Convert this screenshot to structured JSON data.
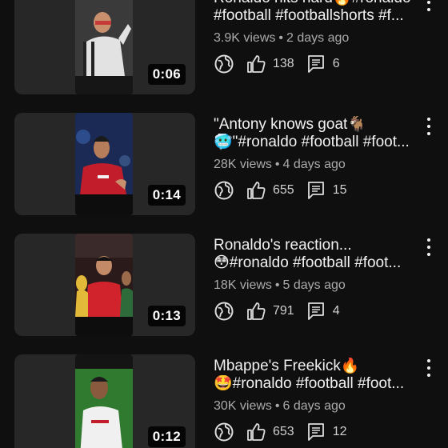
{
  "videos": [
    {
      "title_line1": "Ronaldo hits hard🔥#ronaldo",
      "title_line2": "#football #footballshorts #f...",
      "views": "3.9K views",
      "age": "2 days ago",
      "likes": "138",
      "comments": "6",
      "duration": "0:06",
      "thumb_colors": [
        "#2a2a2a",
        "#d9d9d9",
        "#c63a3a"
      ]
    },
    {
      "title_line1": "\"Antony knows goat🐐",
      "title_line2": "🥶\"#ronaldo #football #foot...",
      "views": "28K views",
      "age": "4 days ago",
      "likes": "655",
      "comments": "15",
      "duration": "0:14",
      "thumb_colors": [
        "#1b2a55",
        "#c21d2a",
        "#e7e7e7"
      ]
    },
    {
      "title_line1": "Ronaldo's reaction...",
      "title_line2": "😳#ronaldo #football #foot...",
      "views": "18K views",
      "age": "5 days ago",
      "likes": "791",
      "comments": "4",
      "duration": "0:13",
      "thumb_colors": [
        "#3a1f1f",
        "#d0232b",
        "#2e6b3a"
      ]
    },
    {
      "title_line1": "Mbappe's Freekick🔥",
      "title_line2": "🤩#ronaldo #football #foot...",
      "views": "30K views",
      "age": "6 days ago",
      "likes": "653",
      "comments": "12",
      "duration": "0:12",
      "thumb_colors": [
        "#2f7a2f",
        "#f0f0f0",
        "#c98f6a"
      ]
    }
  ],
  "separator": "•",
  "icons": {
    "remix": "remix-globe-icon",
    "like": "thumbs-up-icon",
    "comment": "comment-icon",
    "more": "more-vert-icon"
  }
}
